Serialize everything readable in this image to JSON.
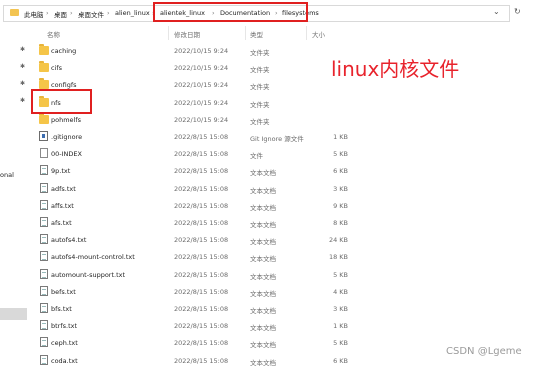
{
  "address_bar": {
    "breadcrumbs": [
      "此电脑",
      "桌面",
      "桌面文件",
      "alien_linux",
      "alientek_linux",
      "Documentation",
      "filesystems"
    ],
    "dropdown_glyph": "⌄",
    "refresh_glyph": "↻"
  },
  "columns": {
    "name": "名称",
    "date": "修改日期",
    "type": "类型",
    "size": "大小"
  },
  "nav": {
    "partial_label": "onal"
  },
  "files": [
    {
      "icon": "folder",
      "name": "caching",
      "date": "2022/10/15 9:24",
      "type": "文件夹",
      "size": ""
    },
    {
      "icon": "folder",
      "name": "cifs",
      "date": "2022/10/15 9:24",
      "type": "文件夹",
      "size": ""
    },
    {
      "icon": "folder",
      "name": "configfs",
      "date": "2022/10/15 9:24",
      "type": "文件夹",
      "size": ""
    },
    {
      "icon": "folder",
      "name": "nfs",
      "date": "2022/10/15 9:24",
      "type": "文件夹",
      "size": ""
    },
    {
      "icon": "folder",
      "name": "pohmelfs",
      "date": "2022/10/15 9:24",
      "type": "文件夹",
      "size": ""
    },
    {
      "icon": "git",
      "name": ".gitignore",
      "date": "2022/8/15 15:08",
      "type": "Git Ignore 源文件",
      "size": "1 KB"
    },
    {
      "icon": "file",
      "name": "00-INDEX",
      "date": "2022/8/15 15:08",
      "type": "文件",
      "size": "5 KB"
    },
    {
      "icon": "txt",
      "name": "9p.txt",
      "date": "2022/8/15 15:08",
      "type": "文本文档",
      "size": "6 KB"
    },
    {
      "icon": "txt",
      "name": "adfs.txt",
      "date": "2022/8/15 15:08",
      "type": "文本文档",
      "size": "3 KB"
    },
    {
      "icon": "txt",
      "name": "affs.txt",
      "date": "2022/8/15 15:08",
      "type": "文本文档",
      "size": "9 KB"
    },
    {
      "icon": "txt",
      "name": "afs.txt",
      "date": "2022/8/15 15:08",
      "type": "文本文档",
      "size": "8 KB"
    },
    {
      "icon": "txt",
      "name": "autofs4.txt",
      "date": "2022/8/15 15:08",
      "type": "文本文档",
      "size": "24 KB"
    },
    {
      "icon": "txt",
      "name": "autofs4-mount-control.txt",
      "date": "2022/8/15 15:08",
      "type": "文本文档",
      "size": "18 KB"
    },
    {
      "icon": "txt",
      "name": "automount-support.txt",
      "date": "2022/8/15 15:08",
      "type": "文本文档",
      "size": "5 KB"
    },
    {
      "icon": "txt",
      "name": "befs.txt",
      "date": "2022/8/15 15:08",
      "type": "文本文档",
      "size": "4 KB"
    },
    {
      "icon": "txt",
      "name": "bfs.txt",
      "date": "2022/8/15 15:08",
      "type": "文本文档",
      "size": "3 KB"
    },
    {
      "icon": "txt",
      "name": "btrfs.txt",
      "date": "2022/8/15 15:08",
      "type": "文本文档",
      "size": "1 KB"
    },
    {
      "icon": "txt",
      "name": "ceph.txt",
      "date": "2022/8/15 15:08",
      "type": "文本文档",
      "size": "5 KB"
    },
    {
      "icon": "txt",
      "name": "coda.txt",
      "date": "2022/8/15 15:08",
      "type": "文本文档",
      "size": "6 KB"
    }
  ],
  "annotation": "linux内核文件",
  "watermark": "CSDN @Lgeme",
  "colors": {
    "highlight": "#e02020",
    "annotation": "#e8232c",
    "folder": "#f5c548"
  }
}
